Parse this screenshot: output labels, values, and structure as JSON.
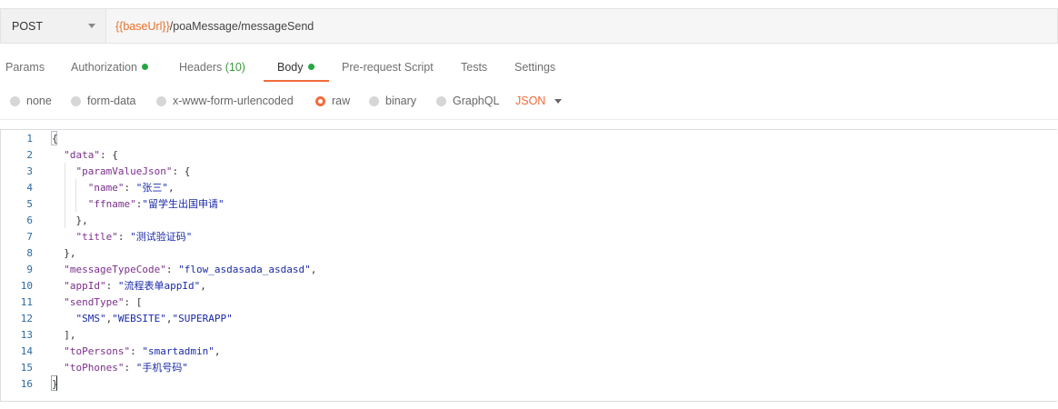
{
  "request": {
    "method": "POST",
    "url_variable": "{{baseUrl}}",
    "url_path": "/poaMessage/messageSend"
  },
  "tabs": [
    {
      "label": "Params"
    },
    {
      "label": "Authorization",
      "has_dot": true
    },
    {
      "label": "Headers",
      "count": "(10)"
    },
    {
      "label": "Body",
      "has_dot": true,
      "active": true
    },
    {
      "label": "Pre-request Script"
    },
    {
      "label": "Tests"
    },
    {
      "label": "Settings"
    }
  ],
  "body_types": [
    {
      "label": "none",
      "checked": false
    },
    {
      "label": "form-data",
      "checked": false
    },
    {
      "label": "x-www-form-urlencoded",
      "checked": false
    },
    {
      "label": "raw",
      "checked": true
    },
    {
      "label": "binary",
      "checked": false
    },
    {
      "label": "GraphQL",
      "checked": false
    }
  ],
  "raw_language": "JSON",
  "editor": {
    "lines": [
      "{",
      "  \"data\": {",
      "    \"paramValueJson\": {",
      "      \"name\": \"张三\",",
      "      \"ffname\":\"留学生出国申请\"",
      "    },",
      "    \"title\": \"测试验证码\"",
      "  },",
      "  \"messageTypeCode\": \"flow_asdasada_asdasd\",",
      "  \"appId\": \"流程表单appId\",",
      "  \"sendType\": [",
      "    \"SMS\",\"WEBSITE\",\"SUPERAPP\"",
      "  ],",
      "  \"toPersons\": \"smartadmin\",",
      "  \"toPhones\": \"手机号码\"",
      "}"
    ]
  },
  "colors": {
    "accent": "#f26b3a",
    "dot_green": "#27a744",
    "json_key": "#7a2f8c",
    "json_string": "#1a2aa8",
    "line_number": "#2b6aa3"
  }
}
